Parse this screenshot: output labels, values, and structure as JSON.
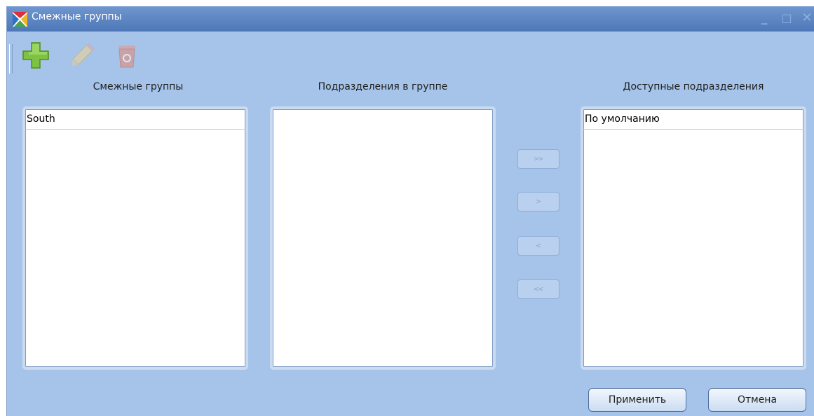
{
  "window": {
    "title": "Смежные группы",
    "minimize_glyph": "_",
    "maximize_glyph": "□",
    "close_glyph": "✕"
  },
  "toolbar": {
    "items": [
      {
        "icon": "add-icon",
        "enabled": true
      },
      {
        "icon": "edit-pencil-icon",
        "enabled": false
      },
      {
        "icon": "recycle-bin-icon",
        "enabled": false
      }
    ]
  },
  "columns": {
    "groups_label": "Смежные группы",
    "in_group_label": "Подразделения в группе",
    "available_label": "Доступные подразделения"
  },
  "lists": {
    "groups": [
      "South"
    ],
    "in_group": [],
    "available": [
      "По умолчанию"
    ]
  },
  "transfer": {
    "add_all": ">>",
    "add_one": ">",
    "remove_one": "<",
    "remove_all": "<<"
  },
  "buttons": {
    "apply": "Применить",
    "cancel": "Отмена"
  },
  "colors": {
    "window_bg": "#a6c4ea",
    "titlebar": "#4d77b7",
    "add_green": "#7dc242"
  }
}
